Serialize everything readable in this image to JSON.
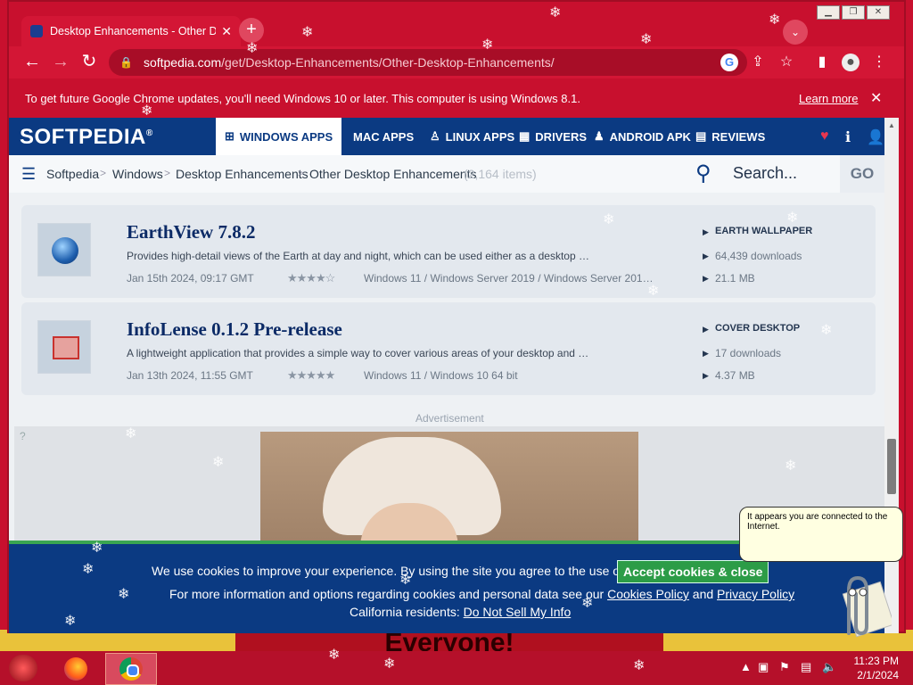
{
  "browser": {
    "tab_title": "Desktop Enhancements - Other Desktop Enhancements",
    "url_host": "softpedia.com",
    "url_path": "/get/Desktop-Enhancements/Other-Desktop-Enhancements/",
    "infobar_text": "To get future Google Chrome updates, you'll need Windows 10 or later. This computer is using Windows 8.1.",
    "infobar_link": "Learn more"
  },
  "site": {
    "logo": "SOFTPEDIA",
    "menu": [
      {
        "label": "WINDOWS APPS",
        "icon": "windows-icon"
      },
      {
        "label": "MAC APPS",
        "icon": "apple-icon"
      },
      {
        "label": "LINUX APPS",
        "icon": "linux-icon"
      },
      {
        "label": "DRIVERS",
        "icon": "drivers-icon"
      },
      {
        "label": "ANDROID APK",
        "icon": "android-icon"
      },
      {
        "label": "REVIEWS",
        "icon": "reviews-icon"
      }
    ],
    "breadcrumb": [
      "Softpedia",
      "Windows",
      "Desktop Enhancements",
      "Other Desktop Enhancements"
    ],
    "item_count": "(2,164 items)",
    "search_placeholder": "Search...",
    "go_label": "GO"
  },
  "apps": [
    {
      "name": "EarthView 7.8.2",
      "description": "Provides high-detail views of the Earth at day and night, which can be used either as a desktop wa...",
      "date": "Jan 15th 2024, 09:17 GMT",
      "stars": "★★★★☆",
      "os": "Windows 11 / Windows Server 2019 / Windows Server 2016 /...",
      "category": "EARTH WALLPAPER",
      "downloads": "64,439 downloads",
      "size": "21.1 MB",
      "rating": 4
    },
    {
      "name": "InfoLense 0.1.2 Pre-release",
      "description": "A lightweight application that provides a simple way to cover various areas of your desktop and pr...",
      "date": "Jan 13th 2024, 11:55 GMT",
      "stars": "★★★★★",
      "os": "Windows 11 / Windows 10 64 bit",
      "category": "COVER DESKTOP",
      "downloads": "17 downloads",
      "size": "4.37 MB",
      "rating": 5
    }
  ],
  "ad": {
    "label": "Advertisement"
  },
  "cookie": {
    "line1": "We use cookies to improve your experience. By using the site you agree to the use of cookies.",
    "accept": "Accept cookies & close",
    "line2_prefix": "For more information and options regarding cookies and personal data see our",
    "cookies_policy": "Cookies Policy",
    "and": "and",
    "privacy_policy": "Privacy Policy",
    "line3_prefix": "California residents:",
    "do_not_sell": "Do Not Sell My Info"
  },
  "assistant": {
    "message": "It appears you are connected to the Internet."
  },
  "desktop": {
    "banner": "Everyone!"
  },
  "taskbar": {
    "time": "11:23 PM",
    "date": "2/1/2024"
  }
}
